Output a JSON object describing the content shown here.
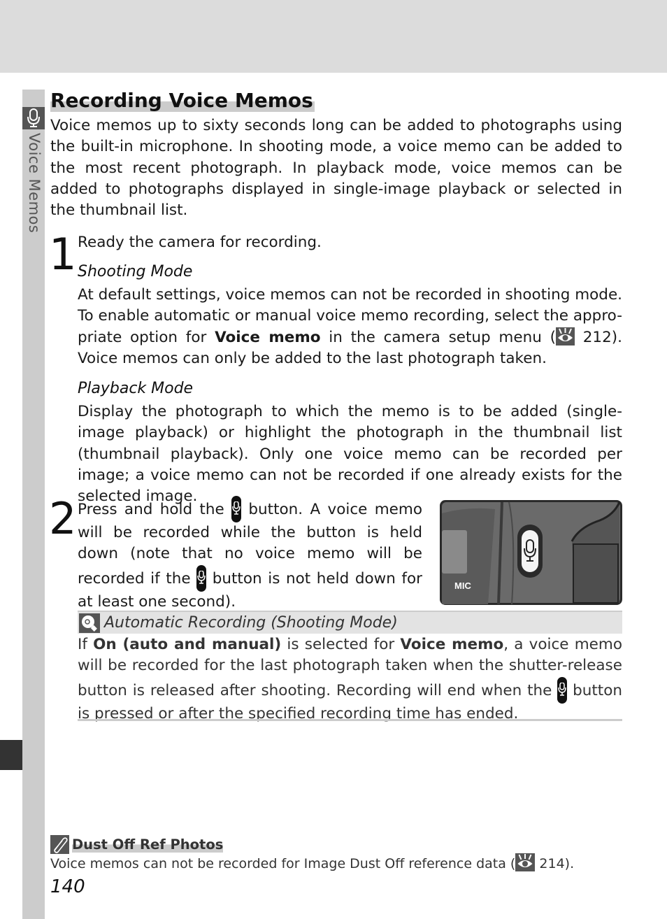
{
  "side_tab": {
    "label": "Voice Memos",
    "icon": "microphone-icon"
  },
  "title": "Recording Voice Memos",
  "intro": "Voice memos up to sixty seconds long can be added to photographs using the built-in microphone.  In shooting mode, a voice memo can be added to the most recent photograph.  In playback mode, voice memos can be added to photographs displayed in single-image playback or selected in the thumbnail list.",
  "step1": {
    "number": "1",
    "text": "Ready the camera for recording.",
    "shooting_mode": {
      "heading": "Shooting Mode",
      "text_before": "At default settings, voice memos can not be recorded in shooting mode.  To enable automatic or manual voice memo recording, select the appro-priate option for ",
      "bold": "Voice memo",
      "text_middle": " in the camera setup menu (",
      "page_ref": "212",
      "text_after": ").  Voice memos can only be added to the last photograph taken."
    },
    "playback_mode": {
      "heading": "Playback Mode",
      "text": "Display the photograph to which the memo is to be added (single-image playback) or highlight the photograph in the thumbnail list (thumbnail playback).  Only one voice memo can be recorded per image; a voice memo can not be recorded if one already exists for the selected image."
    }
  },
  "step2": {
    "number": "2",
    "text_a": "Press and hold the ",
    "text_b": " button.  A voice memo will be recorded while the button is held down (note that no voice memo will be recorded if the ",
    "text_c": " button is not held down for at least one second).",
    "image_label": "MIC"
  },
  "note": {
    "title": "Automatic Recording (Shooting Mode)",
    "text_a": "If ",
    "bold_a": "On (auto and manual)",
    "text_b": " is selected for ",
    "bold_b": "Voice memo",
    "text_c": ", a voice memo will be recorded for the last photograph taken when the shutter-release button is released after shooting.  Recording will end when the ",
    "text_d": " button is pressed or after the specified recording time has ended."
  },
  "dust": {
    "title": "Dust Off Ref Photos",
    "text_before": "Voice memos can not be recorded for Image Dust Off reference data (",
    "page_ref": "214",
    "text_after": ")."
  },
  "page_number": "140"
}
